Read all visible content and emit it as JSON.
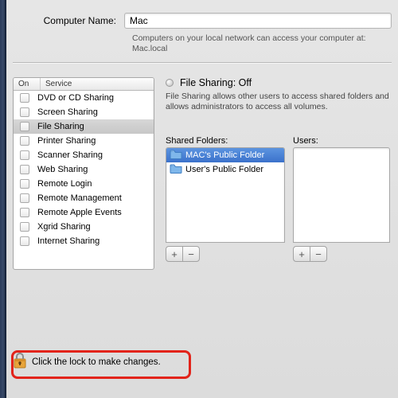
{
  "header": {
    "name_label": "Computer Name:",
    "name_value": "Mac",
    "hint_line1": "Computers on your local network can access your computer at:",
    "hint_line2": "Mac.local"
  },
  "services": {
    "col_on": "On",
    "col_service": "Service",
    "items": [
      {
        "label": "DVD or CD Sharing",
        "on": false,
        "selected": false
      },
      {
        "label": "Screen Sharing",
        "on": false,
        "selected": false
      },
      {
        "label": "File Sharing",
        "on": false,
        "selected": true
      },
      {
        "label": "Printer Sharing",
        "on": false,
        "selected": false
      },
      {
        "label": "Scanner Sharing",
        "on": false,
        "selected": false
      },
      {
        "label": "Web Sharing",
        "on": false,
        "selected": false
      },
      {
        "label": "Remote Login",
        "on": false,
        "selected": false
      },
      {
        "label": "Remote Management",
        "on": false,
        "selected": false
      },
      {
        "label": "Remote Apple Events",
        "on": false,
        "selected": false
      },
      {
        "label": "Xgrid Sharing",
        "on": false,
        "selected": false
      },
      {
        "label": "Internet Sharing",
        "on": false,
        "selected": false
      }
    ]
  },
  "detail": {
    "status_title": "File Sharing: Off",
    "desc": "File Sharing allows other users to access shared folders and allows administrators to access all volumes.",
    "shared_label": "Shared Folders:",
    "users_label": "Users:",
    "shared_items": [
      {
        "label": "MAC's Public Folder",
        "selected": true
      },
      {
        "label": "User's Public Folder",
        "selected": false
      }
    ],
    "plus": "+",
    "minus": "−"
  },
  "lock": {
    "text": "Click the lock to make changes."
  }
}
